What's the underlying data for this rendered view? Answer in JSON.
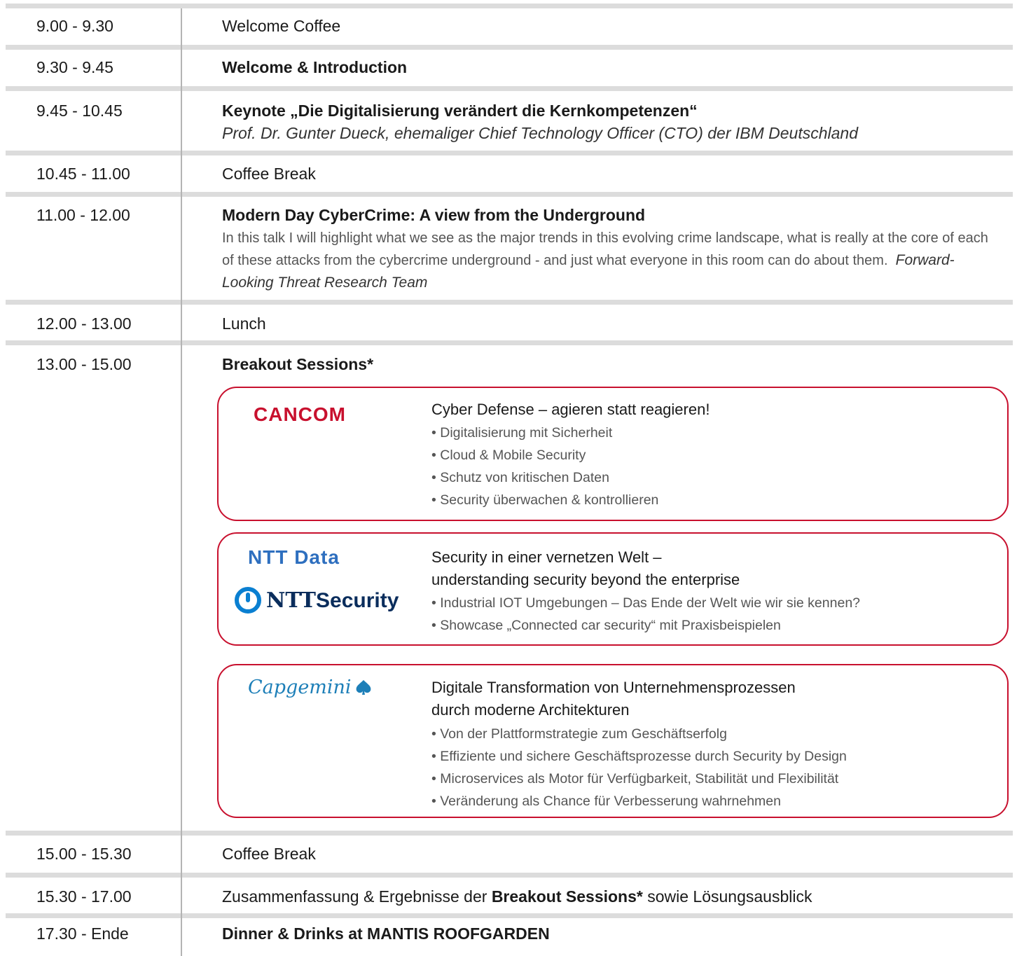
{
  "schedule": [
    {
      "time": "9.00  -  9.30",
      "title": "Welcome Coffee"
    },
    {
      "time": "9.30  -  9.45",
      "title": "Welcome & Introduction"
    },
    {
      "time": "9.45  -  10.45",
      "title": "Keynote „Die Digitalisierung verändert die Kernkompetenzen“",
      "speaker": "Prof. Dr. Gunter Dueck, ehemaliger Chief Technology Officer (CTO) der IBM Deutschland"
    },
    {
      "time": "10.45 - 11.00",
      "title": "Coffee Break"
    },
    {
      "time": "11.00 - 12.00",
      "title": "Modern Day CyberCrime: A view from the Underground",
      "description": "In this talk I will highlight what we see as the major trends in this evolving crime landscape, what is really at the core of each of these attacks from the cybercrime underground - and just what everyone in this room can do about them.",
      "speaker": "Forward-Looking Threat Research Team"
    },
    {
      "time": "12.00 - 13.00",
      "title": "Lunch"
    },
    {
      "time": "13.00 - 15.00",
      "title": "Breakout Sessions*"
    },
    {
      "time": "15.00 - 15.30",
      "title": "Coffee Break"
    },
    {
      "time": "15.30 - 17.00",
      "title_pre": "Zusammenfassung & Ergebnisse der ",
      "title_bold": "Breakout Sessions*",
      "title_post": " sowie Lösungsausblick"
    },
    {
      "time": "17.30  -  Ende",
      "title": "Dinner & Drinks at MANTIS ROOFGARDEN"
    }
  ],
  "breakouts": [
    {
      "logos": [
        "CANCOM"
      ],
      "title_lines": [
        "Cyber Defense – agieren statt reagieren!"
      ],
      "bullets": [
        "• Digitalisierung mit Sicherheit",
        "• Cloud & Mobile Security",
        "• Schutz von kritischen Daten",
        "• Security überwachen & kontrollieren"
      ]
    },
    {
      "logos": [
        "NTT Data",
        "NTT",
        "Security"
      ],
      "title_lines": [
        "Security in einer vernetzen Welt –",
        "understanding security beyond the enterprise"
      ],
      "bullets": [
        "• Industrial IOT Umgebungen – Das Ende der Welt wie wir sie kennen?",
        "• Showcase „Connected car security“ mit Praxisbeispielen"
      ]
    },
    {
      "logos": [
        "Capgemini"
      ],
      "title_lines": [
        "Digitale Transformation von Unternehmensprozessen",
        "durch moderne Architekturen"
      ],
      "bullets": [
        "• Von der Plattformstrategie zum Geschäftserfolg",
        "• Effiziente und sichere Geschäftsprozesse durch Security by Design",
        "• Microservices als Motor für Verfügbarkeit, Stabilität und Flexibilität",
        "• Veränderung als Chance für Verbesserung wahrnehmen"
      ]
    }
  ],
  "colors": {
    "accent_border": "#c8102e",
    "cancom": "#c8102e",
    "ntt_data": "#2e6fbf",
    "ntt_security": "#0a5c9e",
    "capgemini": "#1d7fb8",
    "separator": "#dcdcdc"
  }
}
